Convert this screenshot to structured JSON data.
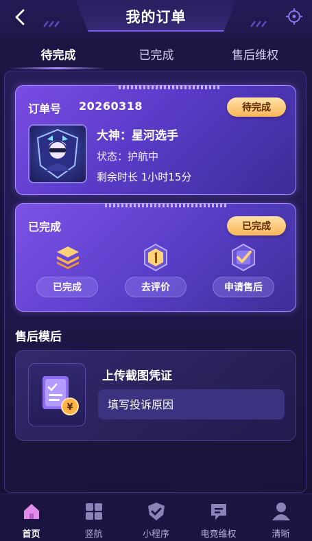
{
  "header": {
    "title": "我的订单"
  },
  "tabs": [
    {
      "label": "待完成",
      "active": true
    },
    {
      "label": "已完成",
      "active": false
    },
    {
      "label": "售后维权",
      "active": false
    }
  ],
  "order_card": {
    "order_label": "订单号",
    "order_number": "20260318",
    "status_badge": "待完成",
    "gamer_name": "大神：星河选手",
    "status_text": "状态：护航中",
    "remaining_time": "剩余时长 1小时15分"
  },
  "completed_card": {
    "label": "已完成",
    "status_badge": "已完成",
    "actions": [
      {
        "label": "已完成",
        "icon": "layers-icon"
      },
      {
        "label": "去评价",
        "icon": "rating-badge-icon"
      },
      {
        "label": "申请售后",
        "icon": "checkmark-icon"
      }
    ]
  },
  "after_sales": {
    "section_title": "售后模后",
    "upload_title": "上传截图凭证",
    "complaint_placeholder": "填写投诉原因"
  },
  "bottom_nav": [
    {
      "label": "首页",
      "icon": "home-icon",
      "active": true
    },
    {
      "label": "竖航",
      "icon": "grid-icon",
      "active": false
    },
    {
      "label": "小程序",
      "icon": "shield-check-icon",
      "active": false
    },
    {
      "label": "电竞维权",
      "icon": "chat-icon",
      "active": false
    },
    {
      "label": "清晰",
      "icon": "user-icon",
      "active": false
    }
  ],
  "colors": {
    "background": "#1a1440",
    "accent": "#7a4ce4",
    "badge": "#f7b658",
    "nav_active": "#e08ce8"
  }
}
